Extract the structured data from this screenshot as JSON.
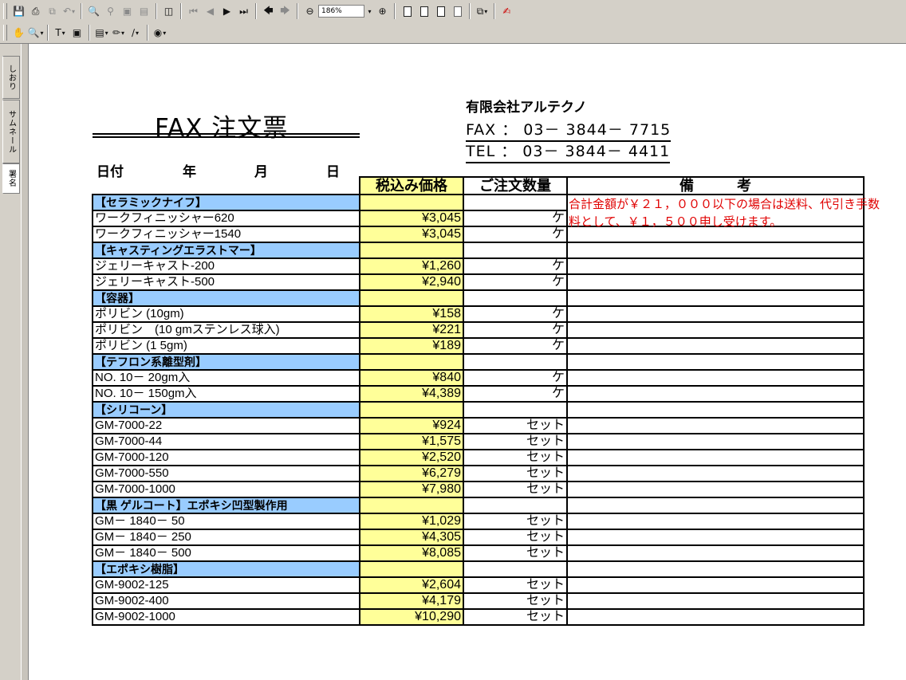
{
  "toolbar": {
    "zoom_value": "186%"
  },
  "sidepanel": {
    "tabs": [
      "しおり",
      "サムネール",
      "署名"
    ]
  },
  "document": {
    "title": "FAX 注文票",
    "company": "有限会社アルテクノ",
    "fax": "FAX ： 03－ 3844－ 7715",
    "tel": "TEL ： 03－ 3844－ 4411",
    "date_label": "日付",
    "year_label": "年",
    "month_label": "月",
    "day_label": "日",
    "header": {
      "price": "税込み価格",
      "qty": "ご注文数量",
      "remarks": "備　　　考"
    },
    "note": "合計金額が￥２１，０００以下の場合は送料、代引き手数料として、￥１，５００申し受けます。",
    "rows": [
      {
        "type": "cat",
        "name": "【セラミックナイフ】"
      },
      {
        "type": "item",
        "name": "ワークフィニッシャー620",
        "price": "¥3,045",
        "qty": "ケ"
      },
      {
        "type": "item",
        "name": "ワークフィニッシャー1540",
        "price": "¥3,045",
        "qty": "ケ"
      },
      {
        "type": "cat",
        "name": "【キャスティングエラストマー】"
      },
      {
        "type": "item",
        "name": "ジェリーキャスト-200",
        "price": "¥1,260",
        "qty": "ケ"
      },
      {
        "type": "item",
        "name": "ジェリーキャスト-500",
        "price": "¥2,940",
        "qty": "ケ"
      },
      {
        "type": "cat",
        "name": "【容器】"
      },
      {
        "type": "item",
        "name": "ポリビン (10gm)",
        "price": "¥158",
        "qty": "ケ"
      },
      {
        "type": "item",
        "name": "ポリビン　(10 gmステンレス球入)",
        "price": "¥221",
        "qty": "ケ"
      },
      {
        "type": "item",
        "name": "ポリビン (1 5gm)",
        "price": "¥189",
        "qty": "ケ"
      },
      {
        "type": "cat",
        "name": "【テフロン系離型剤】"
      },
      {
        "type": "item",
        "name": "NO. 10－ 20gm入",
        "price": "¥840",
        "qty": "ケ"
      },
      {
        "type": "item",
        "name": "NO. 10－ 150gm入",
        "price": "¥4,389",
        "qty": "ケ"
      },
      {
        "type": "cat",
        "name": "【シリコーン】"
      },
      {
        "type": "item",
        "name": "GM-7000-22",
        "price": "¥924",
        "qty": "セット"
      },
      {
        "type": "item",
        "name": "GM-7000-44",
        "price": "¥1,575",
        "qty": "セット"
      },
      {
        "type": "item",
        "name": "GM-7000-120",
        "price": "¥2,520",
        "qty": "セット"
      },
      {
        "type": "item",
        "name": "GM-7000-550",
        "price": "¥6,279",
        "qty": "セット"
      },
      {
        "type": "item",
        "name": "GM-7000-1000",
        "price": "¥7,980",
        "qty": "セット"
      },
      {
        "type": "cat",
        "name": "【黒 ゲルコート】エポキシ凹型製作用"
      },
      {
        "type": "item",
        "name": "GM－ 1840－ 50",
        "price": "¥1,029",
        "qty": "セット"
      },
      {
        "type": "item",
        "name": "GM－ 1840－ 250",
        "price": "¥4,305",
        "qty": "セット"
      },
      {
        "type": "item",
        "name": "GM－ 1840－ 500",
        "price": "¥8,085",
        "qty": "セット"
      },
      {
        "type": "cat",
        "name": "【エポキシ樹脂】"
      },
      {
        "type": "item",
        "name": "GM-9002-125",
        "price": "¥2,604",
        "qty": "セット"
      },
      {
        "type": "item",
        "name": "GM-9002-400",
        "price": "¥4,179",
        "qty": "セット"
      },
      {
        "type": "item",
        "name": "GM-9002-1000",
        "price": "¥10,290",
        "qty": "セット"
      }
    ]
  }
}
